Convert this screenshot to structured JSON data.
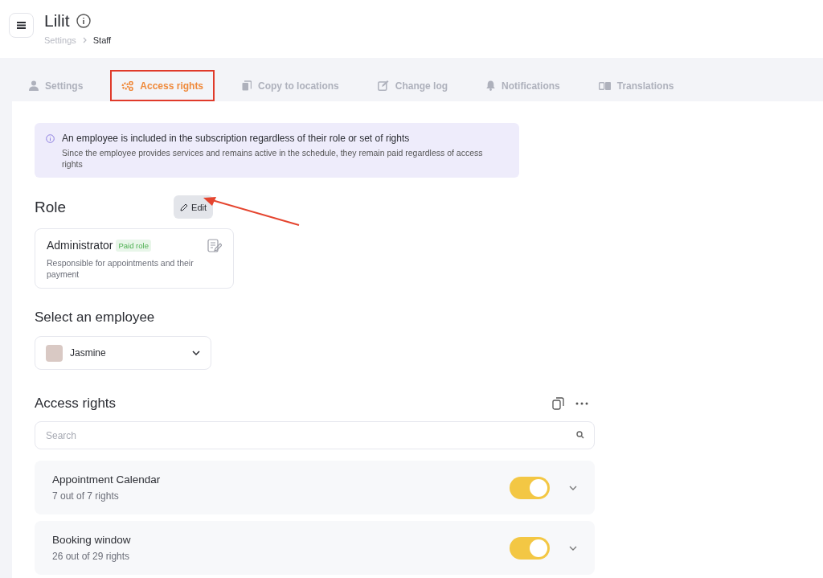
{
  "header": {
    "title": "Lilit",
    "breadcrumb": [
      "Settings",
      "Staff"
    ]
  },
  "tabs": [
    {
      "label": "Settings",
      "selected": false
    },
    {
      "label": "Access rights",
      "selected": true
    },
    {
      "label": "Copy to locations",
      "selected": false
    },
    {
      "label": "Change log",
      "selected": false
    },
    {
      "label": "Notifications",
      "selected": false
    },
    {
      "label": "Translations",
      "selected": false
    }
  ],
  "notice": {
    "title": "An employee is included in the subscription regardless of their role or set of rights",
    "text": "Since the employee provides services and remains active in the schedule, they remain paid regardless of access rights"
  },
  "role": {
    "heading": "Role",
    "edit_button": "Edit",
    "name": "Administrator",
    "badge": "Paid role",
    "description": "Responsible for appointments and their payment"
  },
  "employee": {
    "heading": "Select an employee",
    "value": "Jasmine"
  },
  "access_rights": {
    "heading": "Access rights",
    "search_placeholder": "Search",
    "items": [
      {
        "name": "Appointment Calendar",
        "count": "7 out of 7 rights",
        "on": true
      },
      {
        "name": "Booking window",
        "count": "26 out of 29 rights",
        "on": true
      }
    ]
  }
}
